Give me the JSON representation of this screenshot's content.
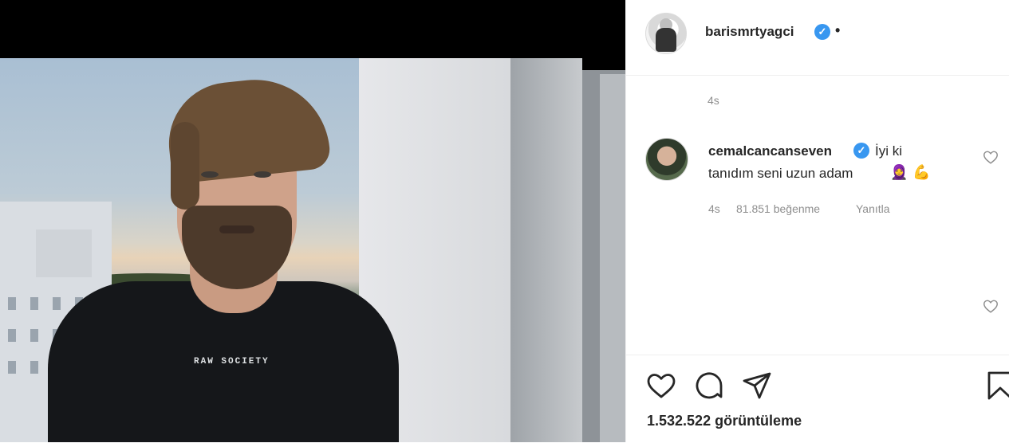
{
  "post": {
    "brand_print": "RAW SOCIETY"
  },
  "header": {
    "username": "barismrtyagci",
    "verified_icon": "verified-check-icon",
    "separator": "•"
  },
  "caption": {
    "time": "4s"
  },
  "comment": {
    "username": "cemalcancanseven",
    "verified_icon": "verified-check-icon",
    "text_line1": "İyi ki",
    "text_line2": "tanıdım seni uzun adam",
    "emojis": [
      "🧕",
      "💪"
    ],
    "time": "4s",
    "likes": "81.851 beğenme",
    "reply": "Yanıtla"
  },
  "actions": {
    "icons": [
      "heart-icon",
      "comment-icon",
      "share-icon",
      "bookmark-icon"
    ],
    "views": "1.532.522 görüntüleme"
  },
  "colors": {
    "verified": "#3897f0",
    "text": "#262626",
    "muted": "#8e8e8e"
  }
}
